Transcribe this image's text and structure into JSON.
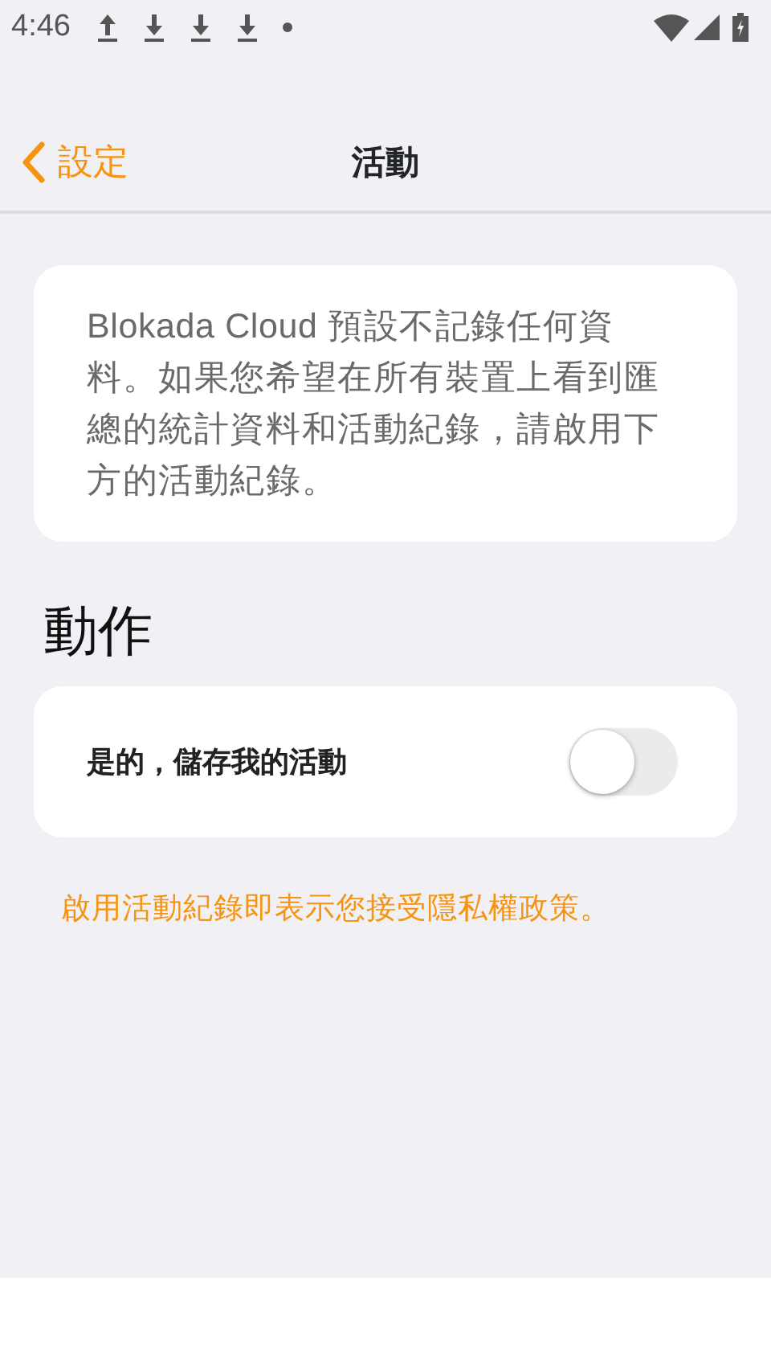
{
  "status_bar": {
    "time": "4:46",
    "notifications": [
      {
        "kind": "upload"
      },
      {
        "kind": "download"
      },
      {
        "kind": "download"
      },
      {
        "kind": "download"
      },
      {
        "kind": "dot"
      }
    ]
  },
  "nav": {
    "back_label": "設定",
    "title": "活動"
  },
  "info_text": "Blokada Cloud 預設不記錄任何資料。如果您希望在所有裝置上看到匯總的統計資料和活動紀錄，請啟用下方的活動紀錄。",
  "section_title": "動作",
  "settings": [
    {
      "label": "是的，儲存我的活動",
      "on": false
    }
  ],
  "policy_link": "啟用活動紀錄即表示您接受隱私權政策。"
}
